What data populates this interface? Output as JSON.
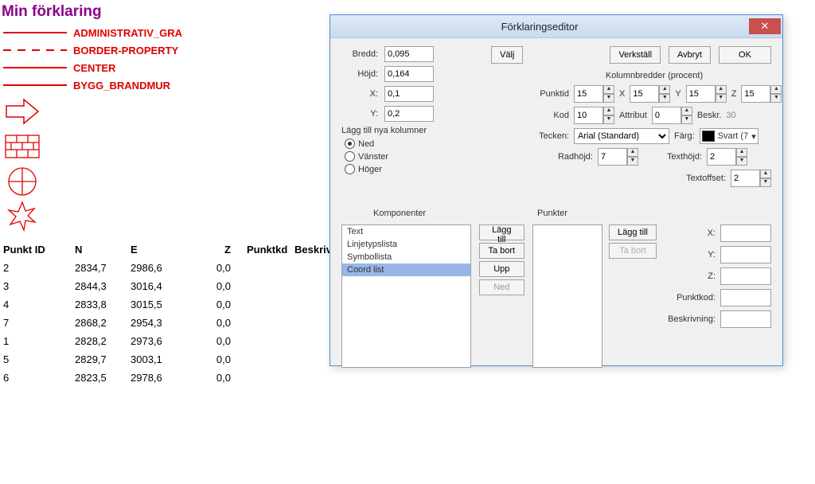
{
  "title": "Min förklaring",
  "legend": [
    {
      "style": "solid-red",
      "label": "ADMINISTRATIV_GRA"
    },
    {
      "style": "dashed-red",
      "label": "BORDER-PROPERTY"
    },
    {
      "style": "solid-red",
      "label": "CENTER"
    },
    {
      "style": "solid-red",
      "label": "BYGG_BRANDMUR"
    }
  ],
  "table": {
    "headers": {
      "id": "Punkt ID",
      "n": "N",
      "e": "E",
      "z": "Z",
      "pk": "Punktkd",
      "desc": "Beskrivning"
    },
    "rows": [
      {
        "id": "2",
        "n": "2834,7",
        "e": "2986,6",
        "z": "0,0"
      },
      {
        "id": "3",
        "n": "2844,3",
        "e": "3016,4",
        "z": "0,0"
      },
      {
        "id": "4",
        "n": "2833,8",
        "e": "3015,5",
        "z": "0,0"
      },
      {
        "id": "7",
        "n": "2868,2",
        "e": "2954,3",
        "z": "0,0"
      },
      {
        "id": "1",
        "n": "2828,2",
        "e": "2973,6",
        "z": "0,0"
      },
      {
        "id": "5",
        "n": "2829,7",
        "e": "3003,1",
        "z": "0,0"
      },
      {
        "id": "6",
        "n": "2823,5",
        "e": "2978,6",
        "z": "0,0"
      }
    ]
  },
  "dialog": {
    "title": "Förklaringseditor",
    "close": "✕",
    "labels": {
      "bredd": "Bredd:",
      "hojd": "Höjd:",
      "x": "X:",
      "y": "Y:",
      "lagg_nya": "Lägg till nya kolumner",
      "ned": "Ned",
      "vanster": "Vänster",
      "hoger": "Höger",
      "komponenter": "Komponenter",
      "punkter": "Punkter",
      "kolbredd_title": "Kolumnbredder (procent)",
      "punktid": "Punktid",
      "xcol": "X",
      "ycol": "Y",
      "zcol": "Z",
      "kod": "Kod",
      "attribut": "Attribut",
      "beskr": "Beskr.",
      "tecken": "Tecken:",
      "farg": "Färg:",
      "radhojd": "Radhöjd:",
      "texthojd": "Texthöjd:",
      "textoffset": "Textoffset:",
      "pf_x": "X:",
      "pf_y": "Y:",
      "pf_z": "Z:",
      "pf_pk": "Punktkod:",
      "pf_be": "Beskrivning:"
    },
    "values": {
      "bredd": "0,095",
      "hojd": "0,164",
      "x": "0,1",
      "y": "0,2",
      "punktid": "15",
      "xcol": "15",
      "ycol": "15",
      "zcol": "15",
      "kod": "10",
      "attribut": "0",
      "beskr": "30",
      "tecken": "Arial (Standard)",
      "farg": "Svart (7",
      "radhojd": "7",
      "texthojd": "2",
      "textoffset": "2"
    },
    "buttons": {
      "valj": "Välj",
      "verkstall": "Verkställ",
      "avbryt": "Avbryt",
      "ok": "OK",
      "laggtill": "Lägg till",
      "tabort": "Ta bort",
      "upp": "Upp",
      "ned": "Ned"
    },
    "komponenter": [
      "Text",
      "Linjetypslista",
      "Symbollista",
      "Coord list"
    ],
    "komponenter_selected": 3
  }
}
